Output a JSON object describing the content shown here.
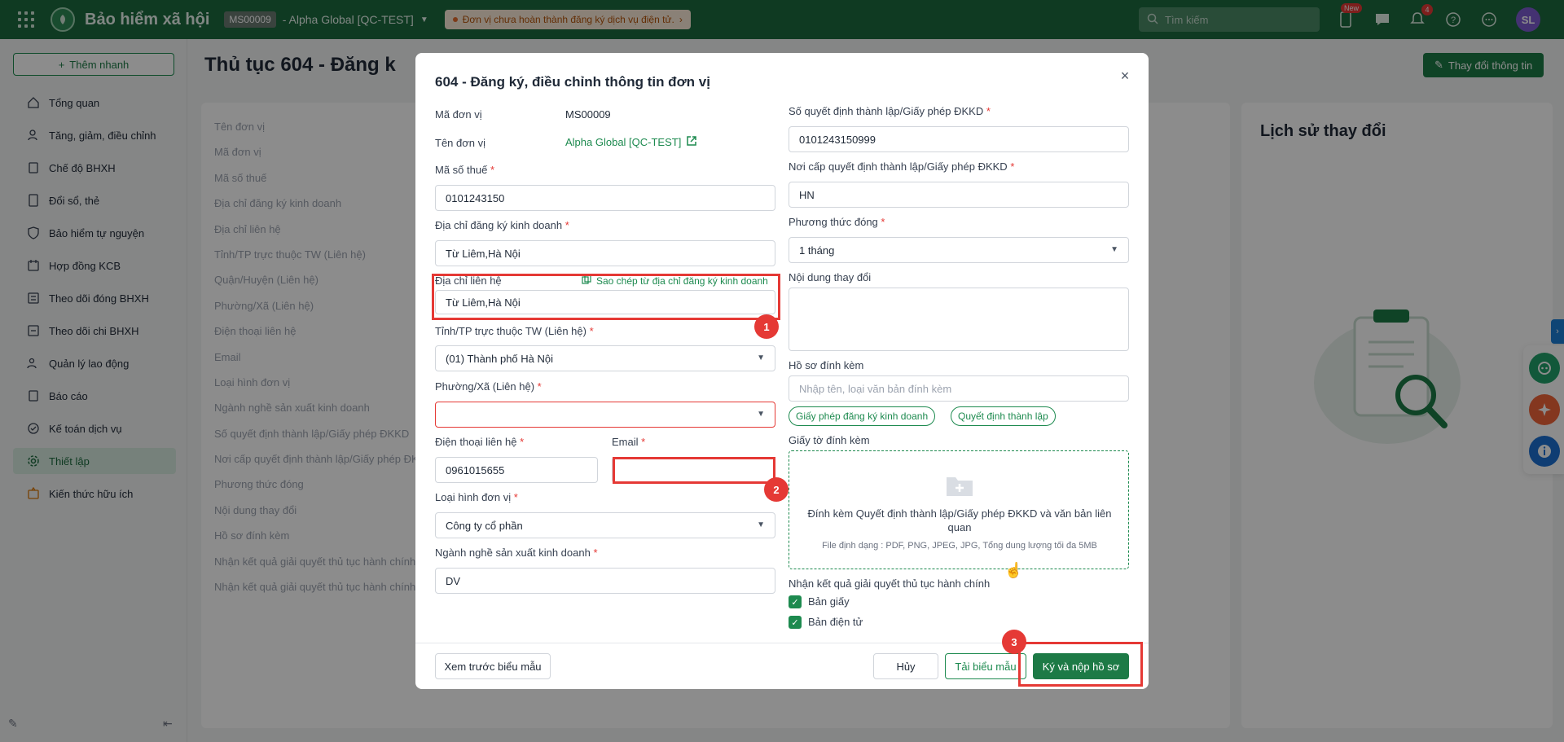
{
  "topbar": {
    "app_title": "Bảo hiểm xã hội",
    "org_code": "MS00009",
    "org_name": "- Alpha Global [QC-TEST]",
    "warning": "Đơn vị chưa hoàn thành đăng ký dịch vụ điện tử.",
    "search_placeholder": "Tìm kiếm",
    "new_badge": "New",
    "notif_count": "4",
    "avatar": "SL"
  },
  "sidebar": {
    "quick_add": "Thêm nhanh",
    "items": [
      {
        "label": "Tổng quan",
        "icon": "home-icon"
      },
      {
        "label": "Tăng, giảm, điều chỉnh",
        "icon": "user-adjust-icon"
      },
      {
        "label": "Chế độ BHXH",
        "icon": "document-icon"
      },
      {
        "label": "Đổi sổ, thẻ",
        "icon": "card-icon"
      },
      {
        "label": "Bảo hiểm tự nguyện",
        "icon": "shield-icon"
      },
      {
        "label": "Hợp đồng KCB",
        "icon": "contract-icon"
      },
      {
        "label": "Theo dõi đóng BHXH",
        "icon": "tracking-icon"
      },
      {
        "label": "Theo dõi chi BHXH",
        "icon": "payout-icon"
      },
      {
        "label": "Quản lý lao động",
        "icon": "people-icon"
      },
      {
        "label": "Báo cáo",
        "icon": "report-icon"
      },
      {
        "label": "Kế toán dịch vụ",
        "icon": "accounting-icon"
      },
      {
        "label": "Thiết lập",
        "icon": "gear-icon"
      },
      {
        "label": "Kiến thức hữu ích",
        "icon": "knowledge-icon"
      }
    ]
  },
  "main": {
    "page_title": "Thủ tục 604 - Đăng k",
    "change_button": "Thay đổi thông tin",
    "bg_labels": [
      "Tên đơn vị",
      "Mã đơn vị",
      "Mã số thuế",
      "Địa chỉ đăng ký kinh doanh",
      "Địa chỉ liên hệ",
      "Tỉnh/TP trực thuộc TW (Liên hệ)",
      "Quận/Huyện (Liên hệ)",
      "Phường/Xã (Liên hệ)",
      "Điện thoại liên hệ",
      "Email",
      "Loại hình đơn vị",
      "Ngành nghề sản xuất kinh doanh",
      "Số quyết định thành lập/Giấy phép ĐKKD",
      "Nơi cấp quyết định thành lập/Giấy phép ĐK",
      "Phương thức đóng",
      "Nội dung thay đổi",
      "Hồ sơ đính kèm",
      "Nhận kết quả giải quyết thủ tục hành chính",
      "Nhận kết quả giải quyết thủ tục hành chính"
    ],
    "history_title": "Lịch sử thay đổi"
  },
  "modal": {
    "title": "604 - Đăng ký, điều chỉnh thông tin đơn vị",
    "unit_code_label": "Mã đơn vị",
    "unit_code": "MS00009",
    "unit_name_label": "Tên đơn vị",
    "unit_name": "Alpha Global [QC-TEST]",
    "tax_label": "Mã số thuế",
    "tax_value": "0101243150",
    "reg_address_label": "Địa chỉ đăng ký kinh doanh",
    "reg_address": "Từ Liêm,Hà Nội",
    "contact_address_label": "Địa chỉ liên hệ",
    "copy_link": "Sao chép từ địa chỉ đăng ký kinh doanh",
    "contact_address": "Từ Liêm,Hà Nội",
    "province_label": "Tỉnh/TP trực thuộc TW (Liên hệ)",
    "province": "(01) Thành phố Hà Nội",
    "ward_label": "Phường/Xã (Liên hệ)",
    "ward": "",
    "phone_label": "Điện thoại liên hệ",
    "phone": "0961015655",
    "email_label": "Email",
    "email": "",
    "unit_type_label": "Loại hình đơn vị",
    "unit_type": "Công ty cổ phần",
    "industry_label": "Ngành nghề sản xuất kinh doanh",
    "industry": "DV",
    "decision_no_label": "Số quyết định thành lập/Giấy phép ĐKKD",
    "decision_no": "0101243150999",
    "decision_place_label": "Nơi cấp quyết định thành lập/Giấy phép ĐKKD",
    "decision_place": "HN",
    "payment_method_label": "Phương thức đóng",
    "payment_method": "1 tháng",
    "change_content_label": "Nội dung thay đổi",
    "attachment_label": "Hồ sơ đính kèm",
    "attachment_placeholder": "Nhập tên, loại văn bản đính kèm",
    "tags": [
      "Giấy phép đăng ký kinh doanh",
      "Quyết định thành lập"
    ],
    "documents_label": "Giấy tờ đính kèm",
    "dropzone_text": "Đính kèm Quyết định thành lập/Giấy phép ĐKKD và văn bản liên quan",
    "dropzone_hint": "File định dạng : PDF, PNG, JPEG, JPG, Tổng dung lượng tối đa 5MB",
    "result_label": "Nhận kết quả giải quyết thủ tục hành chính",
    "result_paper": "Bản giấy",
    "result_electronic": "Bản điện tử",
    "preview_button": "Xem trước biểu mẫu",
    "cancel_button": "Hủy",
    "download_button": "Tải biểu mẫu",
    "submit_button": "Ký và nộp hồ sơ",
    "required_mark": "*",
    "close_glyph": "×",
    "check_glyph": "✓"
  },
  "annotations": [
    "1",
    "2",
    "3"
  ],
  "colors": {
    "brand": "#1d6b3f",
    "primary": "#1d7a46",
    "error": "#e53935"
  }
}
